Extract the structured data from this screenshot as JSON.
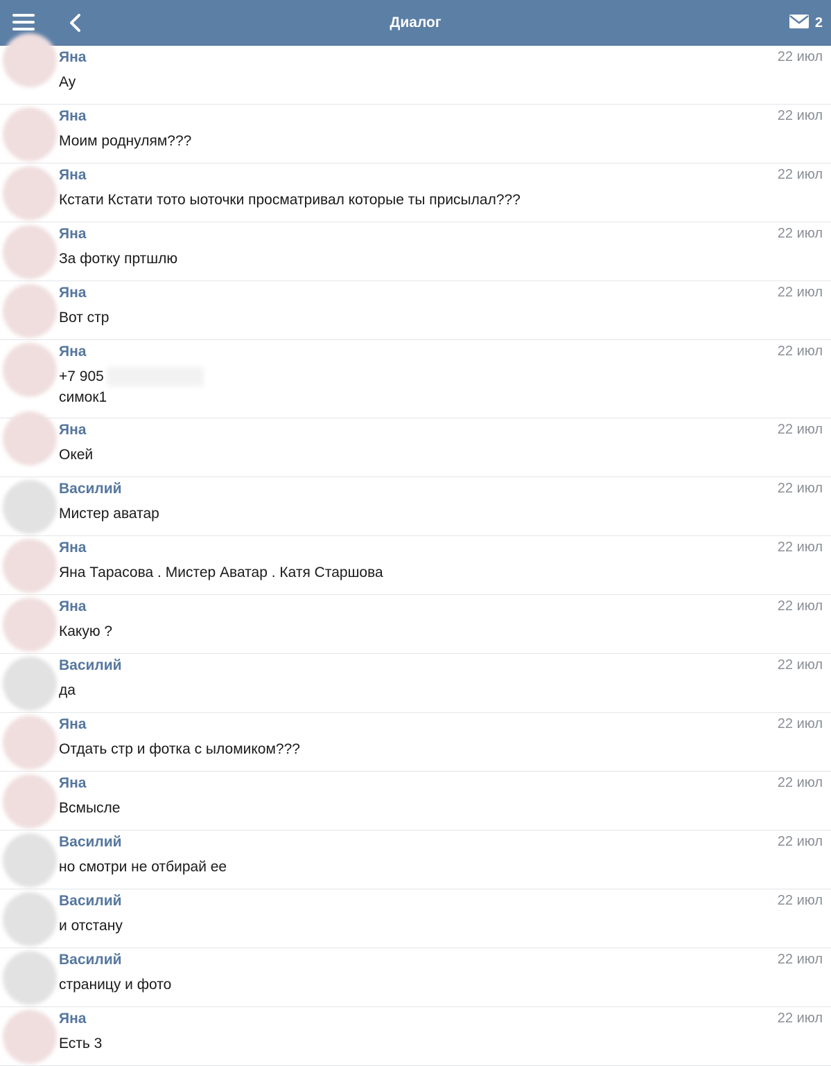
{
  "header": {
    "title": "Диалог",
    "mail_count": "2"
  },
  "messages": [
    {
      "sender": "Яна",
      "date": "22 июл",
      "text": "Ау"
    },
    {
      "sender": "Яна",
      "date": "22 июл",
      "text": "Моим роднулям???"
    },
    {
      "sender": "Яна",
      "date": "22 июл",
      "text": "Кстати Кстати тото ыоточки просматривал которые ты присылал???"
    },
    {
      "sender": "Яна",
      "date": "22 июл",
      "text": "За фотку пртшлю"
    },
    {
      "sender": "Яна",
      "date": "22 июл",
      "text": "Вот стр"
    },
    {
      "sender": "Яна",
      "date": "22 июл",
      "text": "+7 905",
      "text2": "симок1"
    },
    {
      "sender": "Яна",
      "date": "22 июл",
      "text": "Окей"
    },
    {
      "sender": "Василий",
      "date": "22 июл",
      "text": "Мистер аватар"
    },
    {
      "sender": "Яна",
      "date": "22 июл",
      "text": "Яна Тарасова . Мистер Аватар . Катя Старшова"
    },
    {
      "sender": "Яна",
      "date": "22 июл",
      "text": "Какую ?"
    },
    {
      "sender": "Василий",
      "date": "22 июл",
      "text": "да"
    },
    {
      "sender": "Яна",
      "date": "22 июл",
      "text": "Отдать стр и фотка с ыломиком???"
    },
    {
      "sender": "Яна",
      "date": "22 июл",
      "text": "Всмысле"
    },
    {
      "sender": "Василий",
      "date": "22 июл",
      "text": "но смотри не отбирай ее"
    },
    {
      "sender": "Василий",
      "date": "22 июл",
      "text": "и отстану"
    },
    {
      "sender": "Василий",
      "date": "22 июл",
      "text": "страницу и фото"
    },
    {
      "sender": "Яна",
      "date": "22 июл",
      "text": "Есть 3"
    }
  ],
  "colors": {
    "header_bg": "#5c7fa6",
    "sender_name": "#55769e",
    "date_text": "#8a8f96"
  },
  "icons": {
    "menu": "menu-icon",
    "back": "back-arrow-icon",
    "mail": "mail-icon"
  }
}
